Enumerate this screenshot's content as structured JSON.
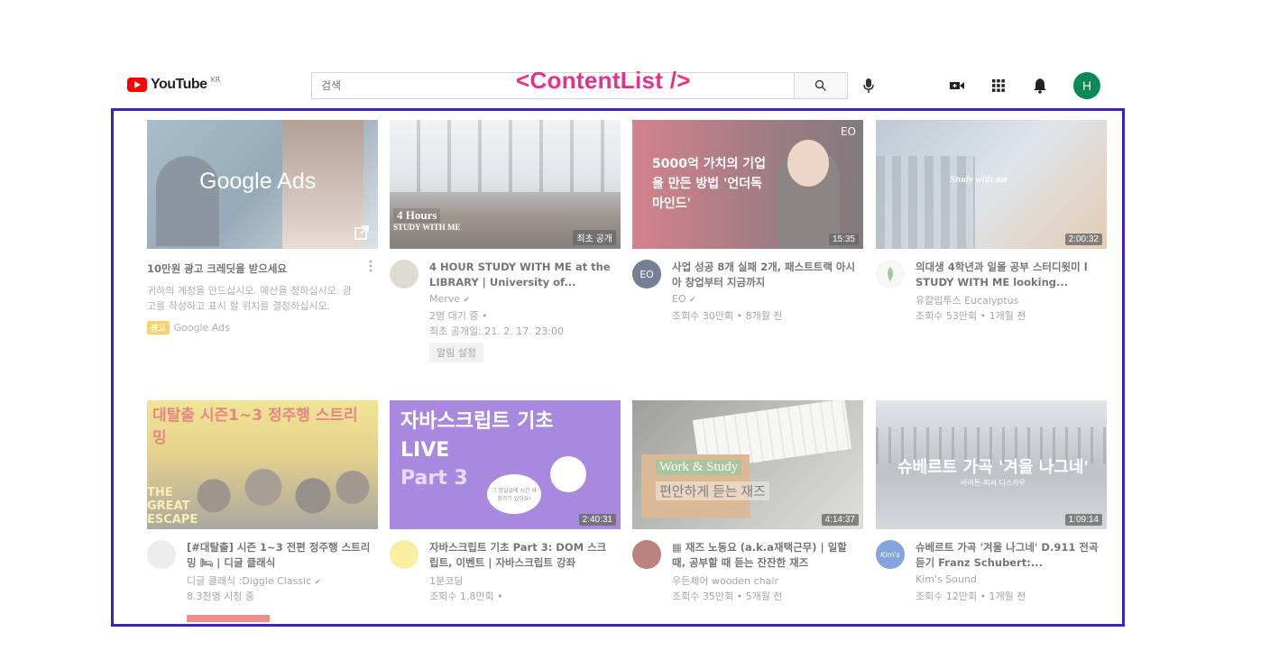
{
  "header": {
    "logo_text": "YouTube",
    "logo_region": "KR",
    "search_placeholder": "검색",
    "avatar_letter": "H",
    "icons": [
      "search-icon",
      "mic-icon",
      "create-video-icon",
      "apps-grid-icon",
      "notifications-bell-icon"
    ]
  },
  "overlay": {
    "label": "<ContentList />"
  },
  "colors": {
    "frame": "#3e21c4",
    "overlay_label": "#e6318a",
    "brand": "#ff0000",
    "avatar": "#0b8a55"
  },
  "ad": {
    "thumb_text": "Google Ads",
    "title": "10만원 광고 크레딧을 받으세요",
    "description": "귀하의 계정을 만드십시오. 예산을 정하십시오. 광고를 작성하고 표시 할 위치를 결정하십시오.",
    "badge": "광고",
    "advertiser": "Google Ads"
  },
  "videos": [
    {
      "thumb_text": "4 Hours",
      "thumb_sub": "STUDY WITH ME",
      "badge": "최초 공개",
      "title": "4 HOUR STUDY WITH ME at the LIBRARY | University of...",
      "channel": "Merve",
      "verified": "✔",
      "line2": "2명 대기 중 •",
      "line3": "최초 공개일: 21. 2. 17. 23:00",
      "button": "알림 설정"
    },
    {
      "thumb_text": "5000억 가치의 기업을 만든 방법 '언더독 마인드'",
      "corner": "EO",
      "duration": "15:35",
      "avatar_text": "EO",
      "title": "사업 성공 8개 실패 2개, 패스트트랙 아시아 창업부터 지금까지",
      "channel": "EO",
      "verified": "✔",
      "line2": "조회수 30만회 • 8개월 전"
    },
    {
      "thumb_text": "Study with me",
      "duration": "2:00:32",
      "title": "의대생 4학년과 일몰 공부 스터디윗미 l STUDY WITH ME looking...",
      "channel": "유칼립투스 Eucalyptus",
      "line2": "조회수 53만회 • 1개월 전"
    },
    {
      "thumb_text": "대탈출 시즌1~3 정주행 스트리밍",
      "thumb_sub": "THE GREAT ESCAPE",
      "title": "[#대탈출] 시즌 1~3 전편 정주행 스트리밍 🛏 | 디글 클래식",
      "channel": "디글 클래식 :Diggle Classic",
      "verified": "✔",
      "line2": "8.3천명 시청 중"
    },
    {
      "thumb_text": "자바스크립트 기초 LIVE",
      "thumb_sub": "Part 3",
      "bubble": "그 망달글에 시간 바로가기 있어요!",
      "duration": "2:40:31",
      "title": "자바스크립트 기초 Part 3: DOM 스크립트, 이벤트 | 자바스크립트 강좌",
      "channel": "1분코딩",
      "line2": "조회수 1.8만회 •"
    },
    {
      "thumb_text": "Work & Study",
      "thumb_sub": "편안하게 듣는 재즈",
      "duration": "4:14:37",
      "title": "▦ 재즈 노동요 (a.k.a재택근무) | 일할 때, 공부할 때 듣는 잔잔한 재즈",
      "channel": "우든체어 wooden chair",
      "line2": "조회수 35만회 • 5개월 전"
    },
    {
      "thumb_text": "슈베르트 가곡 '겨울 나그네'",
      "thumb_sub": "바리톤-피셔 디스카우",
      "duration": "1:09:14",
      "avatar_text": "Kim's",
      "title": "슈베르트 가곡 '겨울 나그네' D.911 전곡듣기 Franz Schubert:...",
      "channel": "Kim's Sound",
      "line2": "조회수 12만회 • 1개월 전"
    }
  ]
}
